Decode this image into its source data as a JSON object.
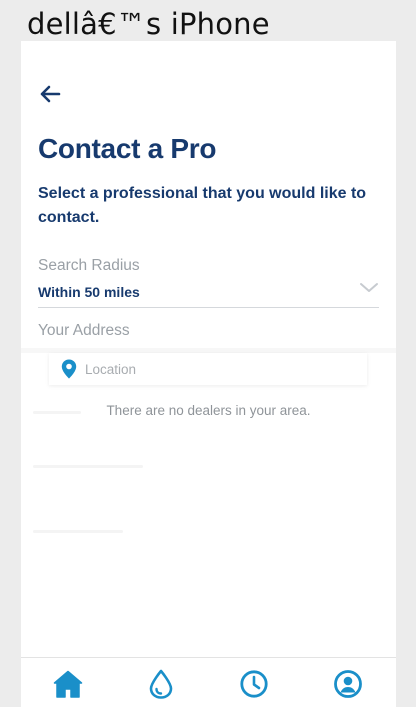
{
  "status": {
    "device_name": "dellâ€™s iPhone"
  },
  "header": {
    "back_icon": "back-arrow-icon"
  },
  "page": {
    "title": "Contact a Pro",
    "subtitle": "Select a professional that you would like to contact."
  },
  "search_radius": {
    "label": "Search Radius",
    "value": "Within 50 miles"
  },
  "address": {
    "label": "Your Address",
    "placeholder": "Location",
    "value": ""
  },
  "results": {
    "empty_message": "There are no dealers in your area."
  },
  "tabbar": {
    "tabs": [
      {
        "icon": "home-icon",
        "active": true
      },
      {
        "icon": "water-drop-icon",
        "active": false
      },
      {
        "icon": "clock-icon",
        "active": false
      },
      {
        "icon": "profile-icon",
        "active": false
      }
    ]
  },
  "colors": {
    "primary_navy": "#173a6e",
    "accent_blue": "#1a8fc9",
    "muted_text": "#9aa0a6",
    "background": "#ececec"
  }
}
